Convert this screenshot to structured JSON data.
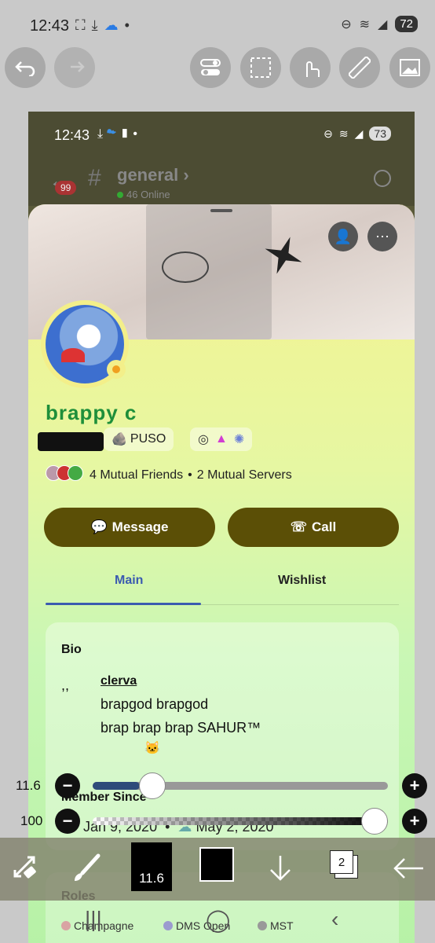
{
  "statusbar": {
    "time": "12:43",
    "left_icons": [
      "screenshot-icon",
      "download-icon",
      "cloud-icon",
      "dot-icon"
    ],
    "right_icons": [
      "dnd-icon",
      "wifi-icon",
      "signal-icon"
    ],
    "battery": "72"
  },
  "toolbar": {
    "undo_icon": "undo-icon",
    "redo_icon": "redo-icon",
    "toggle_icon": "toggle-icon",
    "select_icon": "selection-icon",
    "gesture_icon": "touch-icon",
    "ruler_icon": "ruler-icon",
    "image_icon": "image-icon"
  },
  "inner_status": {
    "time": "12:43",
    "battery": "73"
  },
  "channel": {
    "badge": "99",
    "name": "general",
    "online": "46 Online"
  },
  "profile": {
    "display_name": "brappy c",
    "tag_puso": "PUSO",
    "mutual_friends": "4 Mutual Friends",
    "separator": "•",
    "mutual_servers": "2 Mutual Servers",
    "message_label": "Message",
    "call_label": "Call",
    "tabs": {
      "main": "Main",
      "wishlist": "Wishlist"
    },
    "bio": {
      "label": "Bio",
      "quote": ",,",
      "link": "clerva",
      "lines": [
        "brapgod brapgod",
        "brap brap brap SAHUR™"
      ]
    },
    "member_since": {
      "label": "Member Since",
      "discord_date": "Jan 9, 2020",
      "separator": "•",
      "server_date": "May 2, 2020"
    },
    "roles": {
      "label": "Roles",
      "items": [
        {
          "name": "Champagne",
          "color": "#d9a3a3"
        },
        {
          "name": "DMS Open",
          "color": "#9b9bcf"
        },
        {
          "name": "MST",
          "color": "#999999"
        }
      ]
    }
  },
  "sliders": {
    "size": {
      "value": "11.6",
      "fraction": 0.16
    },
    "opacity": {
      "value": "100",
      "fraction": 1.0
    },
    "minus": "−",
    "plus": "+"
  },
  "bottombar": {
    "brush_size": "11.6",
    "layer_count": "2"
  },
  "colors": {
    "accent_button": "#5b4f06",
    "name_green": "#1e8f3a",
    "tab_blue": "#3b5bb0"
  }
}
